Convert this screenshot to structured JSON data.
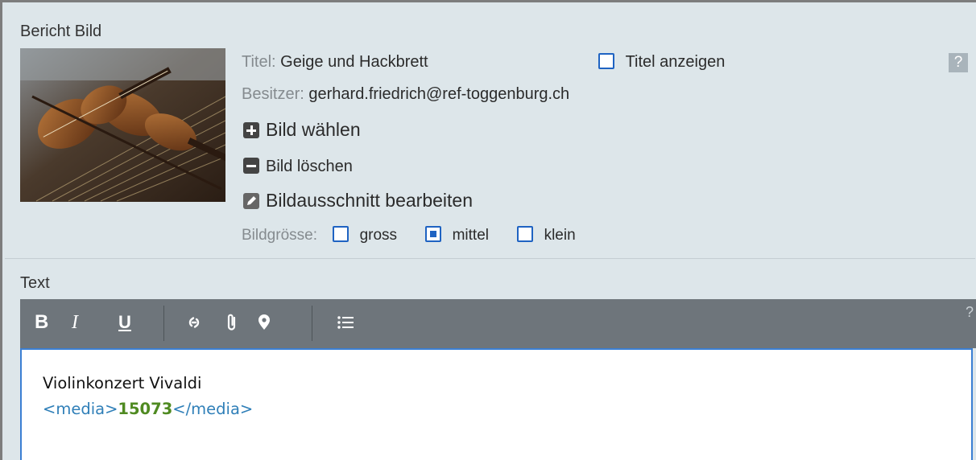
{
  "image_section": {
    "label": "Bericht Bild",
    "title_key": "Titel:",
    "title_value": "Geige und Hackbrett",
    "show_title_label": "Titel anzeigen",
    "show_title_checked": false,
    "owner_key": "Besitzer:",
    "owner_value": "gerhard.friedrich@ref-toggenburg.ch",
    "choose_image": "Bild wählen",
    "delete_image": "Bild löschen",
    "edit_crop": "Bildausschnitt bearbeiten",
    "size_label": "Bildgrösse:",
    "sizes": [
      {
        "label": "gross",
        "checked": false
      },
      {
        "label": "mittel",
        "checked": true
      },
      {
        "label": "klein",
        "checked": false
      }
    ],
    "help": "?"
  },
  "text_section": {
    "label": "Text",
    "help": "?",
    "toolbar": {
      "bold": "B",
      "italic": "I",
      "underline": "U",
      "list": "list-icon",
      "link": "link-icon",
      "attach": "paperclip-icon",
      "location": "map-pin-icon"
    },
    "content_line1": "Violinkonzert Vivaldi",
    "media_open": "<media>",
    "media_id": "15073",
    "media_close": "</media>"
  },
  "colors": {
    "panel_bg": "#dde6ea",
    "toolbar_bg": "#6e757b",
    "checkbox": "#1f63c2",
    "editor_border": "#3b7fd3",
    "tag": "#2f7fb8",
    "tag_value": "#4f8a21"
  }
}
